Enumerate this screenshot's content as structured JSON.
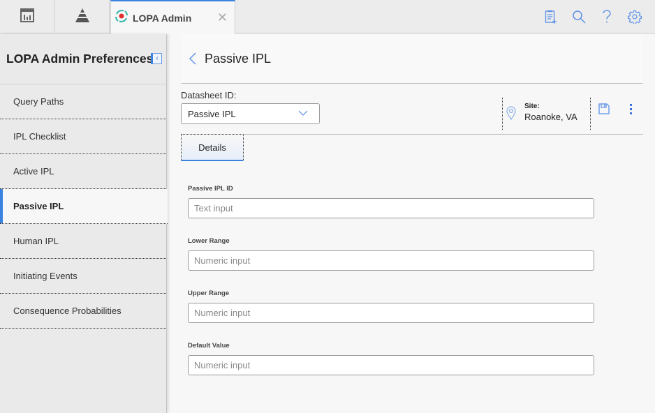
{
  "topbar": {
    "buttons": [
      {
        "icon": "dashboard-icon"
      },
      {
        "icon": "pyramid-icon"
      }
    ],
    "tab": {
      "icon": "lopa-admin-icon",
      "title": "LOPA Admin",
      "close_icon": "close-icon",
      "close_glyph": "✕"
    },
    "right_icons": [
      "clipboard-add-icon",
      "search-icon",
      "help-icon",
      "gear-icon"
    ]
  },
  "sidebar": {
    "title": "LOPA Admin Preferences",
    "collapse_glyph": "‹",
    "items": [
      {
        "label": "Query Paths",
        "active": false
      },
      {
        "label": "IPL Checklist",
        "active": false
      },
      {
        "label": "Active IPL",
        "active": false
      },
      {
        "label": "Passive IPL",
        "active": true
      },
      {
        "label": "Human IPL",
        "active": false
      },
      {
        "label": "Initiating Events",
        "active": false
      },
      {
        "label": "Consequence Probabilities",
        "active": false
      }
    ]
  },
  "main": {
    "title": "Passive IPL",
    "datasheet": {
      "label": "Datasheet ID:",
      "selected": "Passive IPL"
    },
    "site": {
      "label": "Site:",
      "value": "Roanoke, VA"
    },
    "tabs": [
      {
        "label": "Details",
        "active": true
      }
    ],
    "fields": [
      {
        "label": "Passive IPL ID",
        "placeholder": "Text input",
        "value": ""
      },
      {
        "label": "Lower Range",
        "placeholder": "Numeric input",
        "value": ""
      },
      {
        "label": "Upper Range",
        "placeholder": "Numeric input",
        "value": ""
      },
      {
        "label": "Default Value",
        "placeholder": "Numeric input",
        "value": ""
      }
    ]
  },
  "colors": {
    "accent": "#3b82e0",
    "icon_blue": "#5b8fe6",
    "teal": "#2bb5a8",
    "red": "#e03030"
  }
}
